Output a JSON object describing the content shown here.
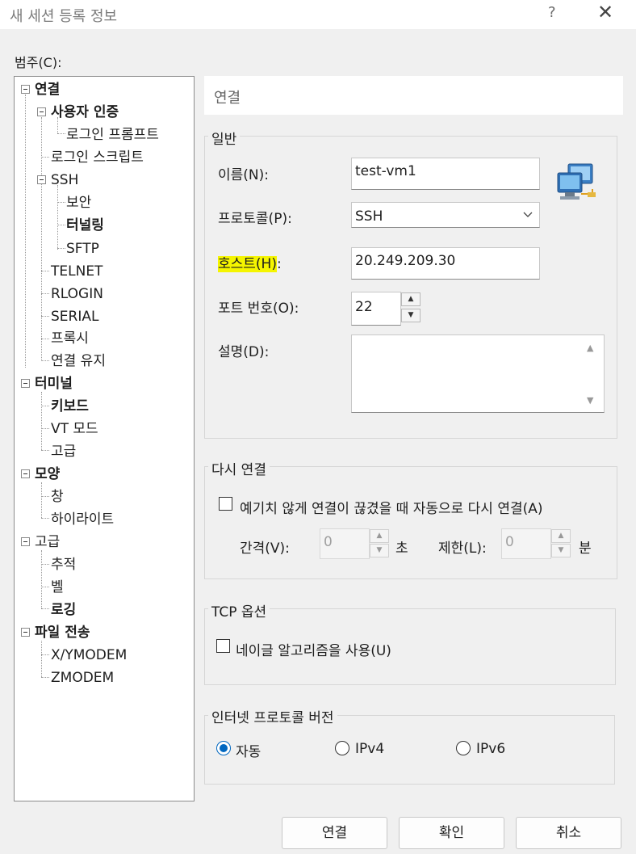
{
  "window": {
    "title": "새 세션 등록 정보",
    "help": "?",
    "close": "✕"
  },
  "category_label": "범주(C):",
  "tree": {
    "n1": "연결",
    "n2": "사용자 인증",
    "n3": "로그인 프롬프트",
    "n4": "로그인 스크립트",
    "n5": "SSH",
    "n6": "보안",
    "n7": "터널링",
    "n8": "SFTP",
    "n9": "TELNET",
    "n10": "RLOGIN",
    "n11": "SERIAL",
    "n12": "프록시",
    "n13": "연결 유지",
    "n14": "터미널",
    "n15": "키보드",
    "n16": "VT 모드",
    "n17": "고급",
    "n18": "모양",
    "n19": "창",
    "n20": "하이라이트",
    "n21": "고급",
    "n22": "추적",
    "n23": "벨",
    "n24": "로깅",
    "n25": "파일 전송",
    "n26": "X/YMODEM",
    "n27": "ZMODEM"
  },
  "panel_header": "연결",
  "general": {
    "title": "일반",
    "name_label": "이름(N):",
    "name_value": "test-vm1",
    "protocol_label": "프로토콜(P):",
    "protocol_value": "SSH",
    "host_label_main": "호스트(H)",
    "host_label_colon": ":",
    "host_value": "20.249.209.30",
    "port_label": "포트 번호(O):",
    "port_value": "22",
    "desc_label": "설명(D):",
    "desc_value": ""
  },
  "reconnect": {
    "title": "다시 연결",
    "auto_label": "예기치 않게 연결이 끊겼을 때 자동으로 다시 연결(A)",
    "interval_label": "간격(V):",
    "interval_value": "0",
    "interval_unit": "초",
    "limit_label": "제한(L):",
    "limit_value": "0",
    "limit_unit": "분"
  },
  "tcp": {
    "title": "TCP 옵션",
    "nagle_label": "네이글 알고리즘을 사용(U)"
  },
  "ipver": {
    "title": "인터넷 프로토콜 버전",
    "auto": "자동",
    "ipv4": "IPv4",
    "ipv6": "IPv6"
  },
  "buttons": {
    "connect": "연결",
    "ok": "확인",
    "cancel": "취소"
  },
  "colors": {
    "accent": "#0067c0",
    "highlight": "#f5f500"
  }
}
